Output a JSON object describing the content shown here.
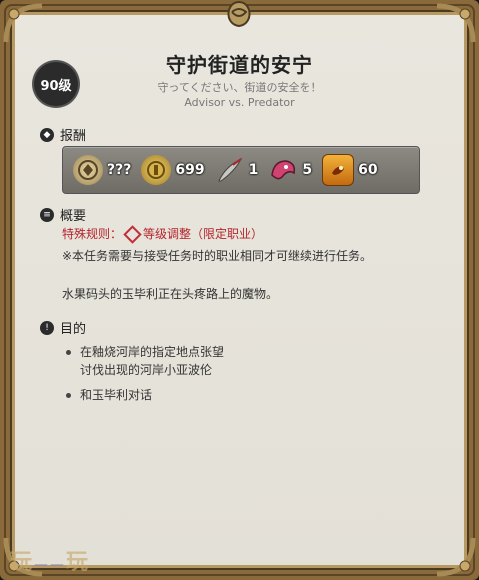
{
  "quest": {
    "level": "90级",
    "title": "守护街道的安宁",
    "subtitle_jp": "守ってください、街道の安全を！",
    "subtitle_en": "Advisor vs. Predator"
  },
  "rewards": {
    "header": "报酬",
    "items": [
      {
        "icon": "coin-token-icon",
        "count": "???"
      },
      {
        "icon": "gil-coin-icon",
        "count": "699"
      },
      {
        "icon": "feather-quill-icon",
        "count": "1"
      },
      {
        "icon": "pink-dragon-mask-icon",
        "count": "5"
      },
      {
        "icon": "scroll-emblem-icon",
        "count": "60"
      }
    ]
  },
  "summary": {
    "header": "概要",
    "special_label": "特殊规则：",
    "special_value": "等级调整（限定职业）",
    "note": "※本任务需要与接受任务时的职业相同才可继续进行任务。",
    "text": "水果码头的玉毕利正在头疼路上的魔物。"
  },
  "objectives": {
    "header": "目的",
    "items": [
      {
        "line1": "在釉烧河岸的指定地点张望",
        "line2": "讨伐出现的河岸小亚波伦"
      },
      {
        "line1": "和玉毕利对话",
        "line2": ""
      }
    ]
  },
  "watermark": {
    "left": "玩",
    "right": "玩"
  }
}
